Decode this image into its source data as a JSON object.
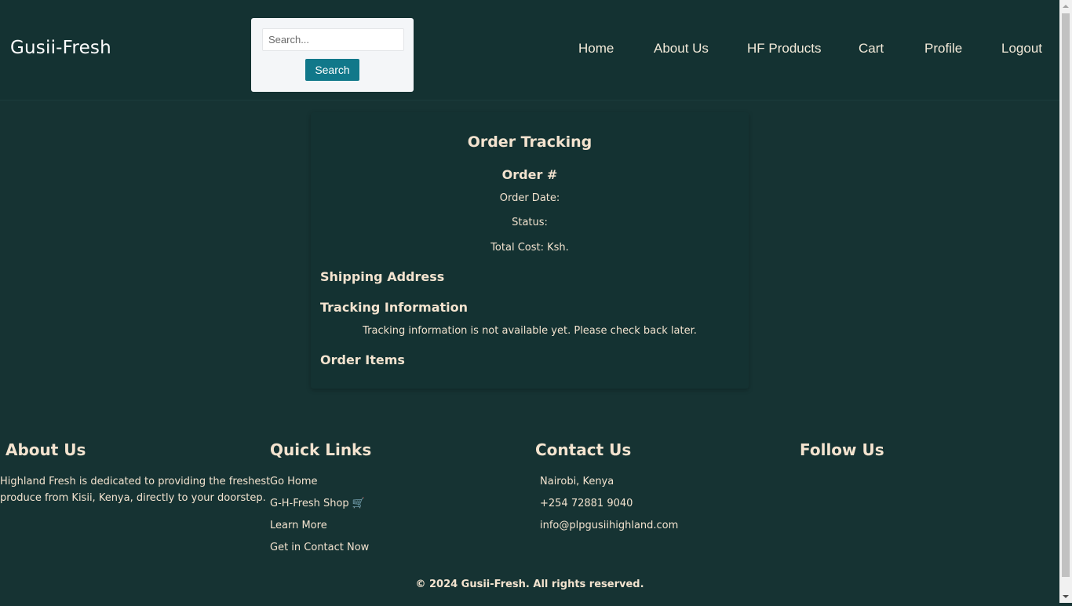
{
  "header": {
    "brand": "Gusii-Fresh",
    "search": {
      "placeholder": "Search...",
      "button_label": "Search"
    },
    "nav": [
      "Home",
      "About Us",
      "HF Products",
      "Cart",
      "Profile",
      "Logout"
    ]
  },
  "order": {
    "title": "Order Tracking",
    "order_number_label": "Order #",
    "order_date_label": "Order Date:",
    "status_label": "Status:",
    "total_cost_label": "Total Cost: Ksh.",
    "shipping_heading": "Shipping Address",
    "tracking_heading": "Tracking Information",
    "tracking_message": "Tracking information is not available yet. Please check back later.",
    "items_heading": "Order Items"
  },
  "footer": {
    "about": {
      "heading": "About Us",
      "line1": "Highland Fresh is dedicated to providing the freshest",
      "line2": "produce from Kisii, Kenya, directly to your doorstep."
    },
    "quick_links": {
      "heading": "Quick Links",
      "links": [
        "Go Home",
        "G-H-Fresh Shop 🛒",
        "Learn More",
        "Get in Contact Now"
      ]
    },
    "contact": {
      "heading": "Contact Us",
      "location": "Nairobi, Kenya",
      "phone": "+254 72881 9040",
      "email": "info@plpgusiihighland.com"
    },
    "follow": {
      "heading": "Follow Us"
    },
    "copyright": "© 2024 Gusii-Fresh. All rights reserved."
  },
  "colors": {
    "background": "#163333",
    "text": "#f3e3cf",
    "accent_button": "#11788a"
  }
}
